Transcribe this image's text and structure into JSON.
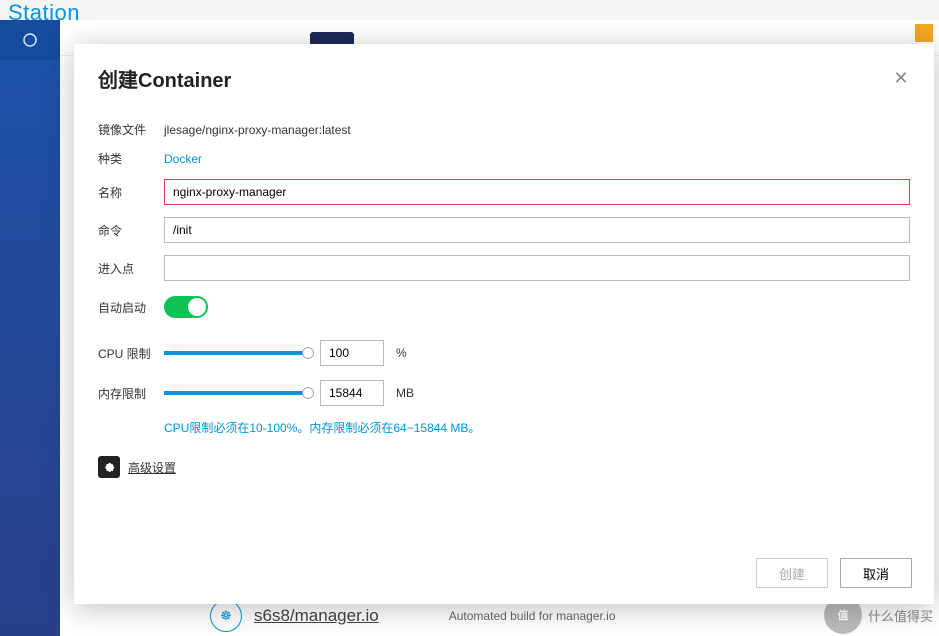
{
  "background": {
    "header_partial": "Station",
    "list_item": {
      "repo": "s6s8/manager.io",
      "desc": "Automated build for manager.io"
    },
    "watermark": "什么值得买",
    "watermark_badge": "值"
  },
  "modal": {
    "title": "创建Container",
    "labels": {
      "image_file": "镜像文件",
      "kind": "种类",
      "name": "名称",
      "command": "命令",
      "entrypoint": "进入点",
      "autostart": "自动启动",
      "cpu_limit": "CPU 限制",
      "mem_limit": "内存限制"
    },
    "values": {
      "image_file": "jlesage/nginx-proxy-manager:latest",
      "kind": "Docker",
      "name": "nginx-proxy-manager",
      "command": "/init",
      "entrypoint": "",
      "autostart": true,
      "cpu_limit_pct": 100,
      "mem_limit_mb": 15844
    },
    "units": {
      "percent": "%",
      "mb": "MB"
    },
    "hint": "CPU限制必须在10-100%。内存限制必须在64−15844 MB。",
    "advanced": "高级设置",
    "buttons": {
      "create": "创建",
      "cancel": "取消"
    }
  }
}
